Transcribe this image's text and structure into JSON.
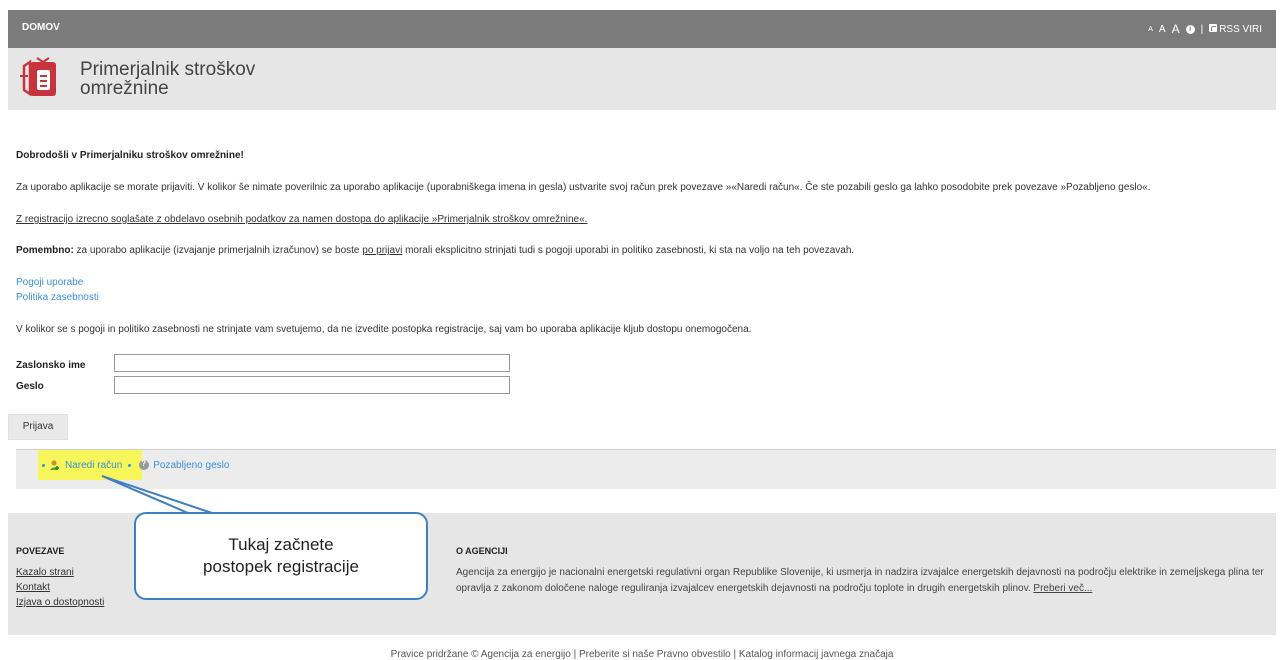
{
  "topbar": {
    "home": "DOMOV",
    "font_small": "A",
    "font_medium": "A",
    "font_large": "A",
    "separator": "|",
    "rss": "RSS VIRI"
  },
  "header": {
    "brand_line1": "Primerjalnik stroškov",
    "brand_line2": "omrežnine"
  },
  "content": {
    "welcome": "Dobrodošli v Primerjalniku stroškov omrežnine!",
    "p1": "Za uporabo aplikacije se morate prijaviti. V kolikor še nimate poverilnic za uporabo aplikacije (uporabniškega imena in gesla) ustvarite svoj račun prek povezave »«Naredi račun«. Če ste pozabili geslo ga lahko posodobite prek povezave »Pozabljeno geslo«.",
    "p2": "Z registracijo izrecno soglašate z obdelavo osebnih podatkov za namen dostopa do aplikacije »Primerjalnik stroškov omrežnine«.",
    "p3_bold": "Pomembno:",
    "p3_a": " za uporabo aplikacije (izvajanje primerjalnih izračunov) se boste ",
    "p3_link": "po prijavi",
    "p3_b": " morali eksplicitno strinjati tudi s pogoji uporabi in politiko zasebnosti, ki sta na voljo na teh povezavah.",
    "link_terms": "Pogoji uporabe",
    "link_privacy": "Politika zasebnosti",
    "p4": "V kolikor se s pogoji in politiko zasebnosti ne strinjate vam svetujemo, da ne izvedite postopka registracije, saj vam bo uporaba aplikacije kljub dostopu onemogočena."
  },
  "form": {
    "username_label": "Zaslonsko ime",
    "username_value": "",
    "password_label": "Geslo",
    "password_value": "",
    "login_button": "Prijava"
  },
  "actions": {
    "create_account": "Naredi račun",
    "forgot_password": "Pozabljeno geslo"
  },
  "callout": {
    "line1": "Tukaj začnete",
    "line2": "postopek registracije"
  },
  "footer": {
    "links_heading": "POVEZAVE",
    "link1": "Kazalo strani",
    "link2": "Kontakt",
    "link3": "Izjava o dostopnosti",
    "about_heading": "O AGENCIJI",
    "about_text": "Agencija za energijo je nacionalni energetski regulativni organ Republike Slovenije, ki usmerja in nadzira izvajalce energetskih dejavnosti na področju elektrike in zemeljskega plina ter opravlja z zakonom določene naloge reguliranja izvajalcev energetskih dejavnosti na področju toplote in drugih energetskih plinov.",
    "read_more": "Preberi več...",
    "bottom": "Pravice pridržane © Agencija za energijo | Preberite si naše Pravno obvestilo | Katalog informacij javnega značaja"
  },
  "colors": {
    "topbar_bg": "#7b7b7b",
    "header_bg": "#e6e6e6",
    "link": "#3b8fd6",
    "logo_red": "#c8343c",
    "highlight": "#f6f55a",
    "callout_border": "#3f7fc1"
  }
}
